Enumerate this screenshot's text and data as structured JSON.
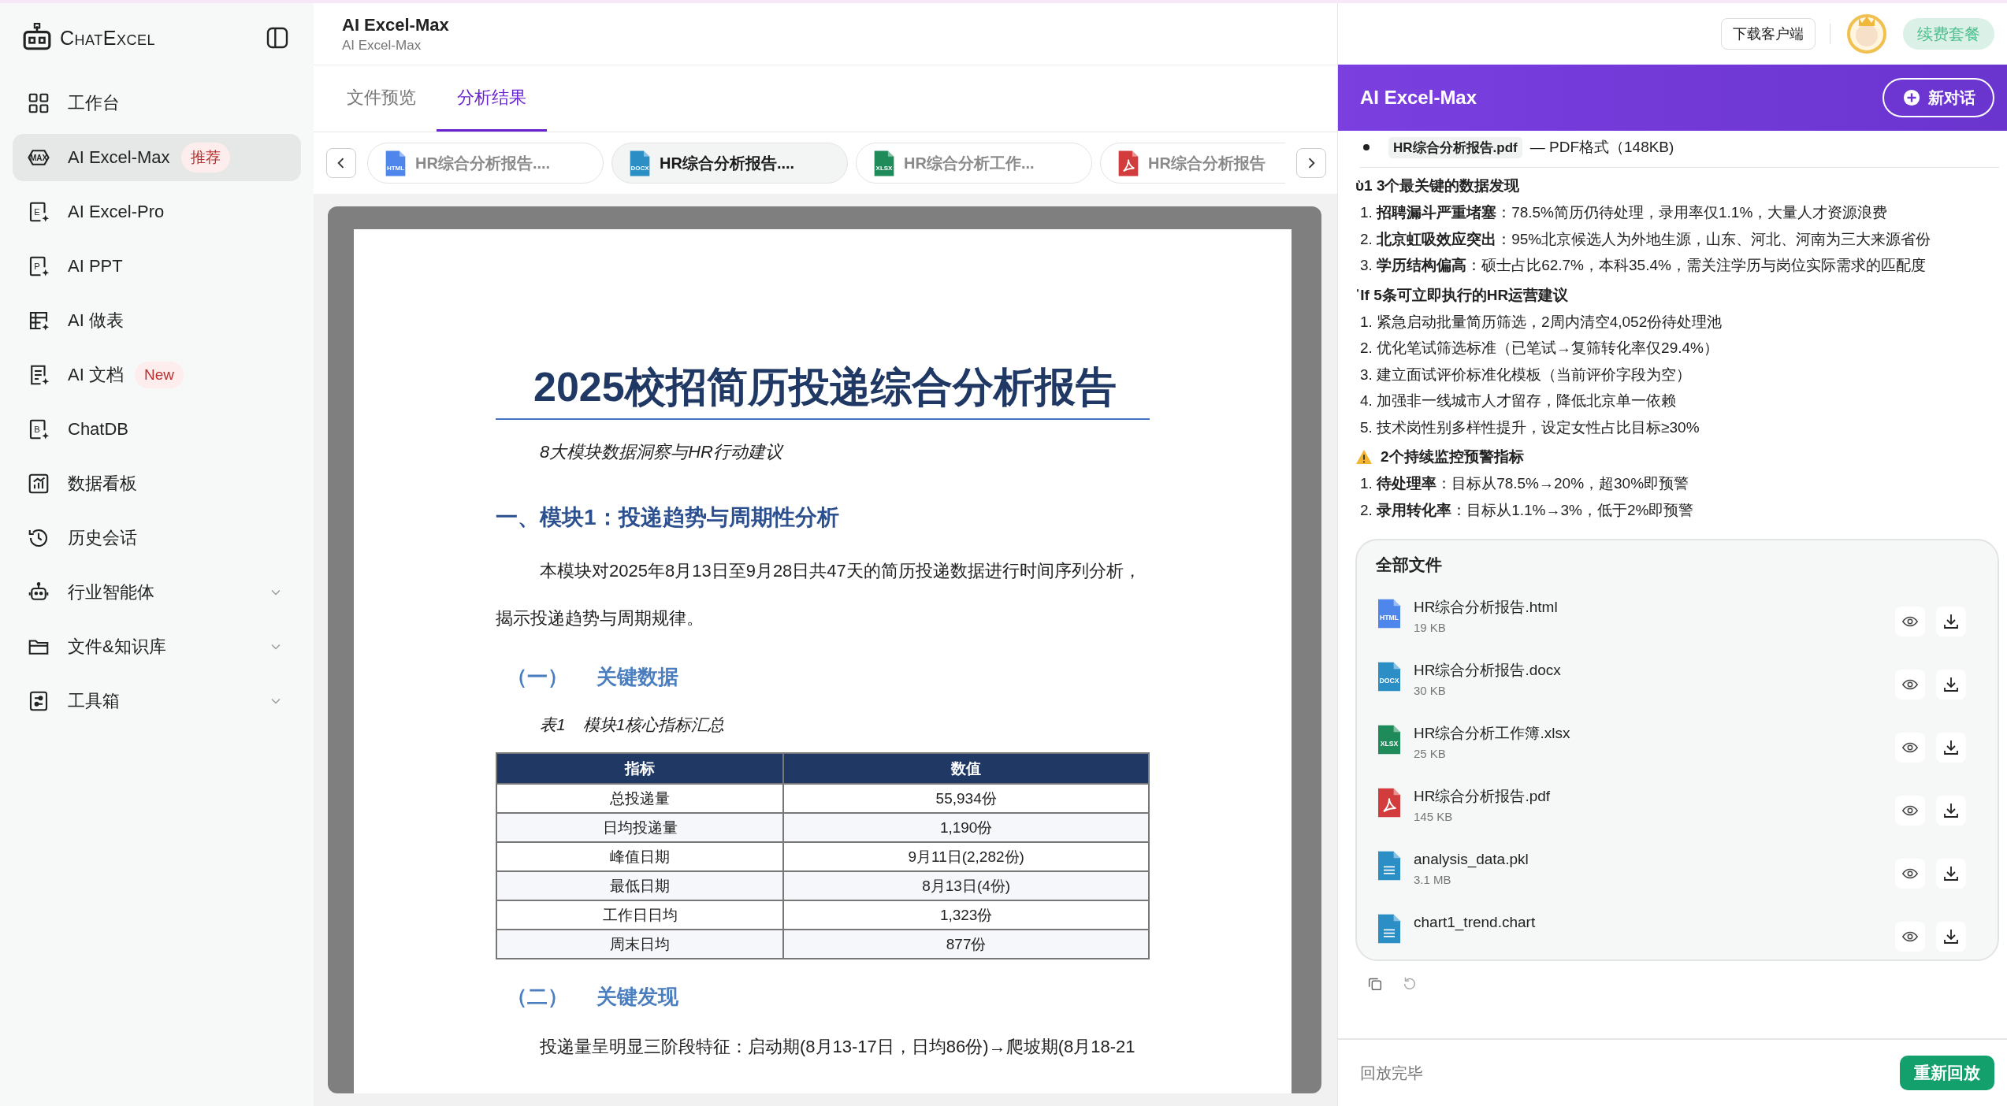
{
  "sidebar": {
    "logo": "ChatExcel",
    "items": [
      {
        "label": "工作台",
        "kind": "link",
        "selected": false
      },
      {
        "label": "AI Excel-Max",
        "kind": "link",
        "selected": true,
        "icon_text": "MAX",
        "badge": "推荐"
      },
      {
        "label": "AI Excel-Pro",
        "kind": "link",
        "selected": false,
        "icon_text": "E"
      },
      {
        "label": "AI PPT",
        "kind": "link",
        "selected": false,
        "icon_text": "P"
      },
      {
        "label": "AI 做表",
        "kind": "link",
        "selected": false
      },
      {
        "label": "AI 文档",
        "kind": "link",
        "selected": false,
        "badge": "New"
      },
      {
        "label": "ChatDB",
        "kind": "link",
        "selected": false,
        "icon_text": "B"
      },
      {
        "label": "数据看板",
        "kind": "link",
        "selected": false
      },
      {
        "label": "历史会话",
        "kind": "link",
        "selected": false
      },
      {
        "label": "行业智能体",
        "kind": "group",
        "selected": false,
        "expanded": false
      },
      {
        "label": "文件&知识库",
        "kind": "group",
        "selected": false,
        "expanded": false
      },
      {
        "label": "工具箱",
        "kind": "group",
        "selected": false,
        "expanded": false
      }
    ]
  },
  "header": {
    "title": "AI Excel-Max",
    "subtitle": "AI Excel-Max"
  },
  "view_tabs": [
    {
      "label": "文件预览",
      "selected": false
    },
    {
      "label": "分析结果",
      "selected": true
    }
  ],
  "file_tabs": [
    {
      "label": "HR综合分析报告....",
      "kind": "html",
      "badge": "HTML",
      "selected": false
    },
    {
      "label": "HR综合分析报告....",
      "kind": "docx",
      "badge": "DOCX",
      "selected": true
    },
    {
      "label": "HR综合分析工作...",
      "kind": "xlsx",
      "badge": "XLSX",
      "selected": false
    },
    {
      "label": "HR综合分析报告",
      "kind": "pdf",
      "selected": false
    }
  ],
  "document": {
    "title": "2025校招简历投递综合分析报告",
    "subtitle": "8大模块数据洞察与HR行动建议",
    "heading": "一、模块1：投递趋势与周期性分析",
    "paragraph": "本模块对2025年8月13日至9月28日共47天的简历投递数据进行时间序列分析，揭示投递趋势与周期规律。",
    "section_1": {
      "number": "（一）",
      "title": "关键数据"
    },
    "caption": {
      "label": "表1",
      "text": "模块1核心指标汇总"
    },
    "table": {
      "columns": [
        "指标",
        "数值"
      ],
      "rows": [
        [
          "总投递量",
          "55,934份"
        ],
        [
          "日均投递量",
          "1,190份"
        ],
        [
          "峰值日期",
          "9月11日(2,282份)"
        ],
        [
          "最低日期",
          "8月13日(4份)"
        ],
        [
          "工作日日均",
          "1,323份"
        ],
        [
          "周末日均",
          "877份"
        ]
      ]
    },
    "section_2": {
      "number": "（二）",
      "title": "关键发现"
    },
    "paragraph_2": "投递量呈明显三阶段特征：启动期(8月13-17日，日均86份)→爬坡期(8月18-21"
  },
  "top_bar": {
    "download_button": "下载客户端",
    "renew_button": "续费套餐"
  },
  "assistant": {
    "title": "AI Excel-Max",
    "new_chat_button": "新对话",
    "attachment": {
      "name": "HR综合分析报告.pdf",
      "text": "— PDF格式（148KB)"
    },
    "sections": [
      {
        "kind": "plain",
        "heading": "ὺ1 3个最关键的数据发现",
        "items": [
          "1. **招聘漏斗严重堵塞**：78.5%简历仍待处理，录用率仅1.1%，大量人才资源浪费",
          "2. **北京虹吸效应突出**：95%北京候选人为外地生源，山东、河北、河南为三大来源省份",
          "3. **学历结构偏高**：硕士占比62.7%，本科35.4%，需关注学历与岗位实际需求的匹配度"
        ]
      },
      {
        "kind": "plain",
        "heading": "῾If 5条可立即执行的HR运营建议",
        "items": [
          "1. 紧急启动批量简历筛选，2周内清空4,052份待处理池",
          "2. 优化笔试筛选标准（已笔试→复筛转化率仅29.4%）",
          "3. 建立面试评价标准化模板（当前评价字段为空）",
          "4. 加强非一线城市人才留存，降低北京单一依赖",
          "5. 技术岗性别多样性提升，设定女性占比目标≥30%"
        ]
      },
      {
        "kind": "warning",
        "heading": "2个持续监控预警指标",
        "items": [
          "1. **待处理率**：目标从78.5%→20%，超30%即预警",
          "2. **录用转化率**：目标从1.1%→3%，低于2%即预警"
        ]
      }
    ],
    "files": {
      "title": "全部文件",
      "items": [
        {
          "name": "HR综合分析报告.html",
          "size": "19 KB",
          "kind": "html",
          "badge": "HTML"
        },
        {
          "name": "HR综合分析报告.docx",
          "size": "30 KB",
          "kind": "docx",
          "badge": "DOCX"
        },
        {
          "name": "HR综合分析工作簿.xlsx",
          "size": "25 KB",
          "kind": "xlsx",
          "badge": "XLSX"
        },
        {
          "name": "HR综合分析报告.pdf",
          "size": "145 KB",
          "kind": "pdf"
        },
        {
          "name": "analysis_data.pkl",
          "size": "3.1 MB",
          "kind": "data"
        },
        {
          "name": "chart1_trend.chart",
          "kind": "data"
        }
      ]
    },
    "status": "回放完毕",
    "replay_button": "重新回放"
  }
}
